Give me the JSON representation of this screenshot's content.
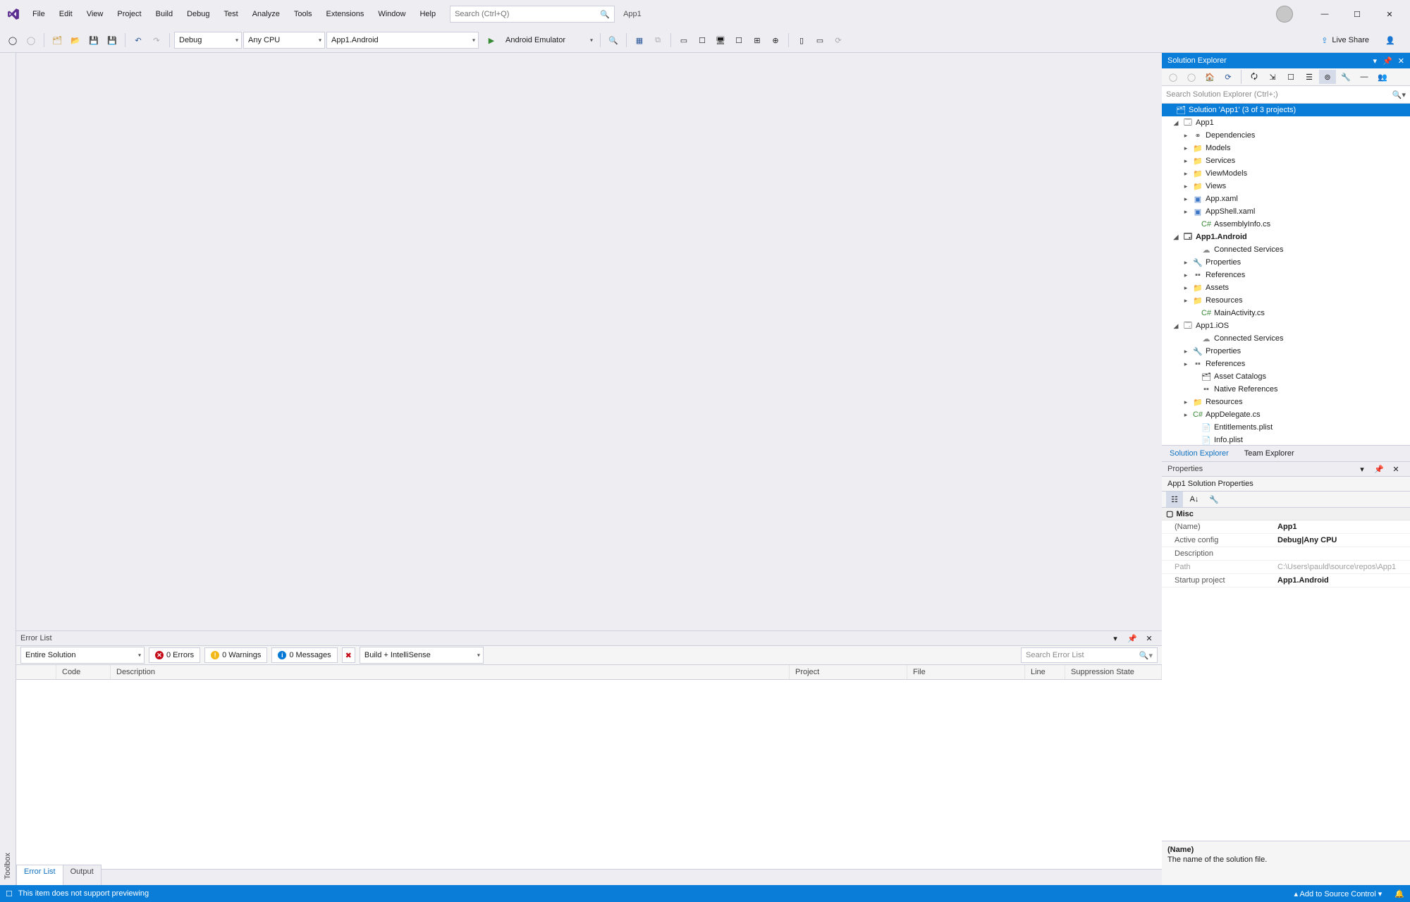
{
  "menu": {
    "file": "File",
    "edit": "Edit",
    "view": "View",
    "project": "Project",
    "build": "Build",
    "debug": "Debug",
    "test": "Test",
    "analyze": "Analyze",
    "tools": "Tools",
    "extensions": "Extensions",
    "window": "Window",
    "help": "Help"
  },
  "title_search_placeholder": "Search (Ctrl+Q)",
  "title_app": "App1",
  "toolbar": {
    "config": "Debug",
    "platform": "Any CPU",
    "startup": "App1.Android",
    "run_target": "Android Emulator"
  },
  "live_share": "Live Share",
  "toolbox_tab": "Toolbox",
  "error_list": {
    "title": "Error List",
    "scope": "Entire Solution",
    "errors": "0 Errors",
    "warnings": "0 Warnings",
    "messages": "0 Messages",
    "build_source": "Build + IntelliSense",
    "search_placeholder": "Search Error List",
    "cols": {
      "code": "Code",
      "description": "Description",
      "project": "Project",
      "file": "File",
      "line": "Line",
      "suppression": "Suppression State"
    }
  },
  "bottom_tabs": {
    "error_list": "Error List",
    "output": "Output"
  },
  "solution_explorer": {
    "title": "Solution Explorer",
    "search_placeholder": "Search Solution Explorer (Ctrl+;)",
    "solution": "Solution 'App1' (3 of 3 projects)",
    "app1": "App1",
    "dependencies": "Dependencies",
    "models": "Models",
    "services": "Services",
    "viewmodels": "ViewModels",
    "views": "Views",
    "app_xaml": "App.xaml",
    "appshell_xaml": "AppShell.xaml",
    "assemblyinfo": "AssemblyInfo.cs",
    "app1_android": "App1.Android",
    "connected_services": "Connected Services",
    "properties": "Properties",
    "references": "References",
    "assets": "Assets",
    "resources": "Resources",
    "mainactivity": "MainActivity.cs",
    "app1_ios": "App1.iOS",
    "asset_catalogs": "Asset Catalogs",
    "native_refs": "Native References",
    "appdelegate": "AppDelegate.cs",
    "entitlements": "Entitlements.plist",
    "info_plist": "Info.plist",
    "tab_solution": "Solution Explorer",
    "tab_team": "Team Explorer"
  },
  "properties": {
    "title": "Properties",
    "subject": "App1 Solution Properties",
    "cat_misc": "Misc",
    "name_k": "(Name)",
    "name_v": "App1",
    "active_k": "Active config",
    "active_v": "Debug|Any CPU",
    "desc_k": "Description",
    "desc_v": "",
    "path_k": "Path",
    "path_v": "C:\\Users\\pauld\\source\\repos\\App1",
    "startup_k": "Startup project",
    "startup_v": "App1.Android",
    "help_h": "(Name)",
    "help_t": "The name of the solution file."
  },
  "status": {
    "msg": "This item does not support previewing",
    "source_control": "Add to Source Control"
  }
}
